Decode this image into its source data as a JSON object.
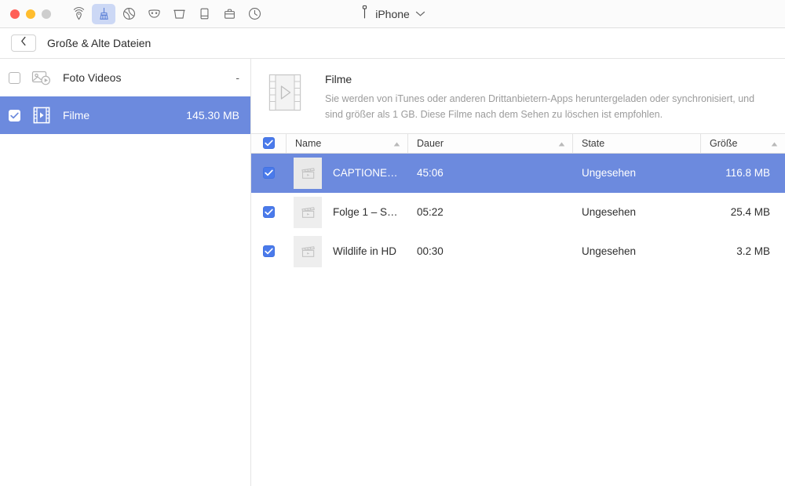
{
  "window": {
    "traffic_lights": [
      {
        "name": "close",
        "color": "#ff5f57"
      },
      {
        "name": "minimize",
        "color": "#ffbd2e"
      },
      {
        "name": "maximize",
        "color": "#cdcdcd"
      }
    ]
  },
  "toolbar": {
    "items": [
      {
        "icon": "airplay-icon",
        "label": "AirPlay",
        "active": false
      },
      {
        "icon": "broom-icon",
        "label": "Clean",
        "active": true
      },
      {
        "icon": "globe-icon",
        "label": "Browser",
        "active": false
      },
      {
        "icon": "mask-icon",
        "label": "Privacy",
        "active": false
      },
      {
        "icon": "trash-bucket-icon",
        "label": "Trash",
        "active": false
      },
      {
        "icon": "device-icon",
        "label": "Device",
        "active": false
      },
      {
        "icon": "briefcase-icon",
        "label": "Toolkit",
        "active": false
      },
      {
        "icon": "clock-history-icon",
        "label": "History",
        "active": false
      }
    ]
  },
  "device_selector": {
    "icon": "lightning-connector-icon",
    "label": "iPhone",
    "chevron": "chevron-down-icon"
  },
  "breadcrumb": {
    "back_icon": "chevron-left-icon",
    "title": "Große & Alte Dateien"
  },
  "sidebar": {
    "items": [
      {
        "name": "Foto Videos",
        "size": "-",
        "checked": false,
        "selected": false,
        "icon": "photo-video-icon"
      },
      {
        "name": "Filme",
        "size": "145.30 MB",
        "checked": true,
        "selected": true,
        "icon": "filmstrip-icon"
      }
    ]
  },
  "detail": {
    "icon": "filmstrip-large-icon",
    "title": "Filme",
    "description": "Sie werden von iTunes oder anderen Drittanbietern-Apps heruntergeladen oder synchronisiert, und sind größer als 1 GB. Diese Filme nach dem Sehen zu löschen ist empfohlen."
  },
  "table": {
    "select_all_checked": true,
    "columns": [
      {
        "key": "name",
        "label": "Name",
        "sortable": true,
        "sort_icon": "sort-ascending-icon"
      },
      {
        "key": "dur",
        "label": "Dauer",
        "sortable": true,
        "sort_icon": "sort-ascending-icon"
      },
      {
        "key": "state",
        "label": "State",
        "sortable": false,
        "sort_icon": ""
      },
      {
        "key": "size",
        "label": "Größe",
        "sortable": true,
        "sort_icon": "sort-ascending-icon"
      }
    ],
    "rows": [
      {
        "checked": true,
        "selected": true,
        "thumb_icon": "clapperboard-icon",
        "name": "CAPTIONE…",
        "dur": "45:06",
        "state": "Ungesehen",
        "size": "116.8 MB"
      },
      {
        "checked": true,
        "selected": false,
        "thumb_icon": "clapperboard-icon",
        "name": "Folge 1 – S…",
        "dur": "05:22",
        "state": "Ungesehen",
        "size": "25.4 MB"
      },
      {
        "checked": true,
        "selected": false,
        "thumb_icon": "clapperboard-icon",
        "name": "Wildlife in HD",
        "dur": "00:30",
        "state": "Ungesehen",
        "size": "3.2 MB"
      }
    ]
  },
  "colors": {
    "selection_blue": "#6c8ade",
    "checkbox_blue": "#4a7aeb",
    "tool_active_bg": "#ccd8f5",
    "muted_text": "#9b9b9b",
    "divider": "#e4e4e4"
  }
}
